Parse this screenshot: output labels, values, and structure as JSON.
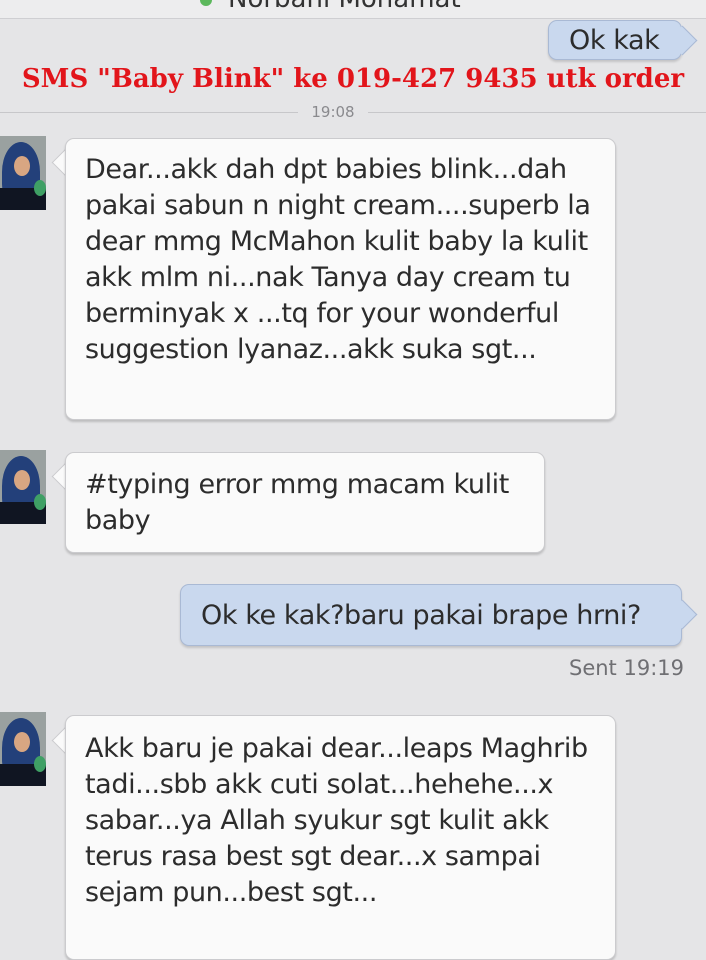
{
  "header": {
    "contact_name": "Norbani Mohamat"
  },
  "promo_banner": "SMS \"Baby Blink\" ke 019-427 9435 utk order",
  "timestamp_divider": "19:08",
  "messages": [
    {
      "direction": "outgoing",
      "text": "Ok kak"
    },
    {
      "direction": "incoming",
      "text": "Dear...akk dah dpt babies blink...dah pakai sabun n night cream....superb la dear mmg McMahon kulit baby la kulit akk mlm ni...nak Tanya day cream tu berminyak x ...tq for your wonderful suggestion lyanaz...akk suka sgt..."
    },
    {
      "direction": "incoming",
      "text": "#typing error mmg macam kulit baby"
    },
    {
      "direction": "outgoing",
      "text": "Ok ke kak?baru pakai brape hrni?",
      "status": "Sent 19:19"
    },
    {
      "direction": "incoming",
      "text": "Akk baru je pakai dear...leaps Maghrib tadi...sbb akk cuti solat...hehehe...x sabar...ya Allah syukur sgt kulit akk terus  rasa best sgt dear...x sampai sejam pun...best sgt..."
    }
  ],
  "colors": {
    "incoming_bubble": "#fafafa",
    "outgoing_bubble": "#c9d8ee",
    "promo_text": "#e2151b",
    "background": "#e5e5e7"
  }
}
